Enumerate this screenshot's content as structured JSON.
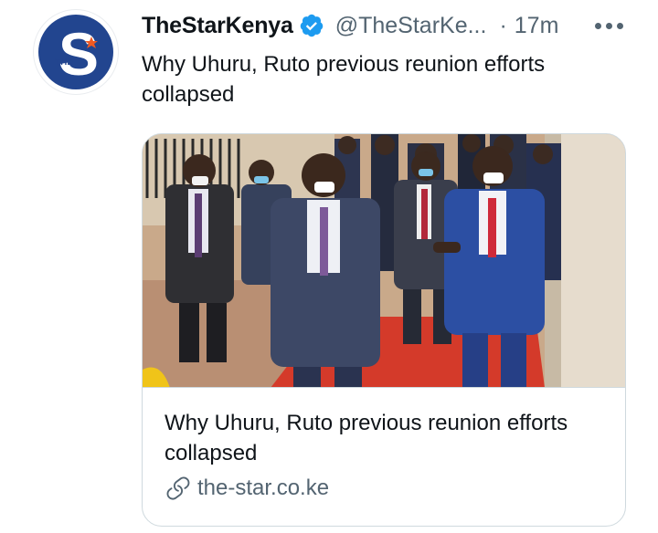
{
  "tweet": {
    "author": {
      "display_name": "TheStarKenya",
      "handle": "@TheStarKe...",
      "verified": true,
      "avatar_letter": "S",
      "avatar_sub": "THE"
    },
    "separator": "·",
    "time": "17m",
    "text": "Why Uhuru, Ruto previous reunion efforts collapsed",
    "card": {
      "title": "Why Uhuru, Ruto previous reunion efforts collapsed",
      "domain": "the-star.co.ke"
    }
  },
  "icons": {
    "verified": "verified-badge-icon",
    "more": "more-horizontal-icon",
    "link": "link-icon"
  },
  "colors": {
    "verified_blue": "#1d9bf0",
    "avatar_navy": "#22458f",
    "avatar_accent": "#f05a23",
    "muted_text": "#536471",
    "card_border": "#cfd9de"
  }
}
